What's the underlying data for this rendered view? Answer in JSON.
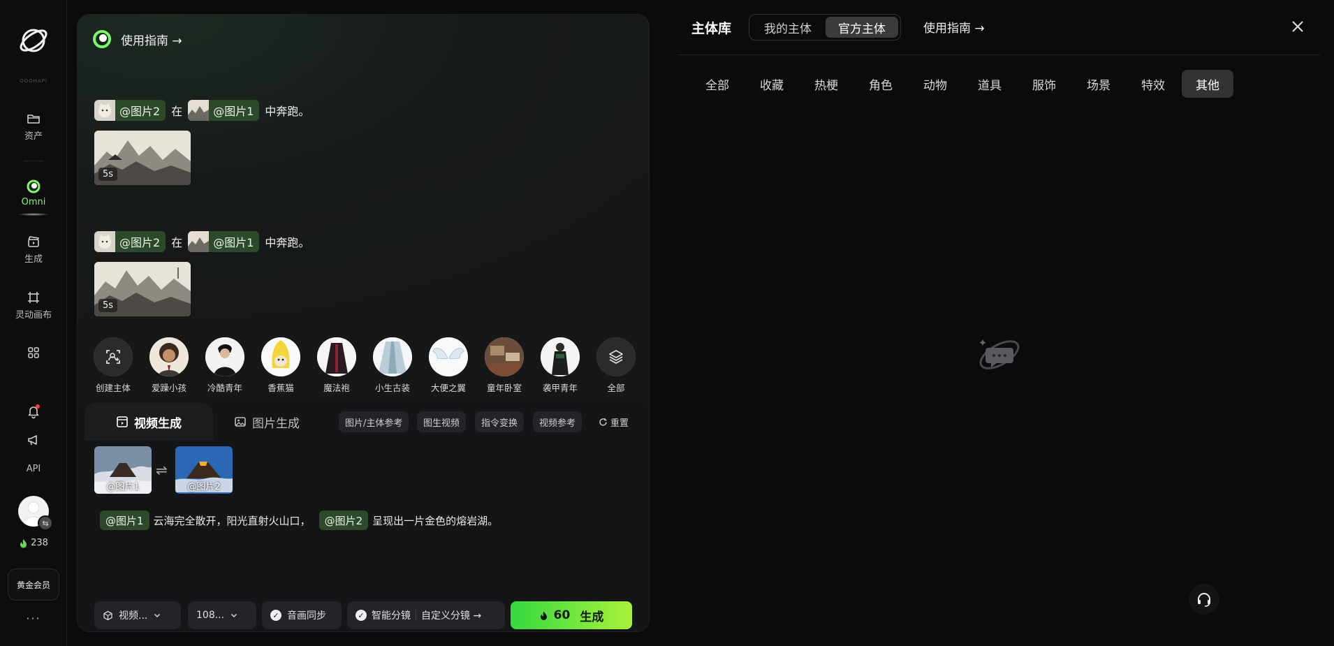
{
  "rail": {
    "brand_small": "OOOHAPI",
    "assets_label": "资产",
    "omni_label": "Omni",
    "generate_label": "生成",
    "canvas_label": "灵动画布",
    "api_label": "API",
    "credits": "238",
    "vip_label": "黄金会员",
    "more_label": "···"
  },
  "main": {
    "guide_label": "使用指南 →",
    "examples": [
      {
        "tag1": "@图片2",
        "connector": "在",
        "tag2": "@图片1",
        "suffix": "中奔跑。",
        "duration": "5s"
      },
      {
        "tag1": "@图片2",
        "connector": "在",
        "tag2": "@图片1",
        "suffix": "中奔跑。",
        "duration": "5s"
      }
    ],
    "characters": [
      {
        "name": "创建主体"
      },
      {
        "name": "爱躁小孩"
      },
      {
        "name": "冷酷青年"
      },
      {
        "name": "香蕉猫"
      },
      {
        "name": "魔法袍"
      },
      {
        "name": "小生古装"
      },
      {
        "name": "大便之翼"
      },
      {
        "name": "童年卧室"
      },
      {
        "name": "袭甲青年"
      },
      {
        "name": "全部"
      }
    ]
  },
  "composer": {
    "tab_video": "视频生成",
    "tab_image": "图片生成",
    "chips": [
      "图片/主体参考",
      "图生视频",
      "指令变换",
      "视频参考"
    ],
    "reset": "重置",
    "ref1": "@图片1",
    "ref2": "@图片2",
    "desc_tag1": "@图片1",
    "desc_text1": "云海完全散开，阳光直射火山口，",
    "desc_tag2": "@图片2",
    "desc_text2": "呈现出一片金色的熔岩湖。",
    "mode_label": "视频...",
    "res_label": "108...",
    "audio_sync": "音画同步",
    "smart_split": "智能分镜",
    "custom_split": "自定义分镜 →",
    "generate_cost": "60",
    "generate_label": "生成"
  },
  "drawer": {
    "title": "主体库",
    "seg_mine": "我的主体",
    "seg_official": "官方主体",
    "guide_label": "使用指南 →",
    "categories": [
      "全部",
      "收藏",
      "热梗",
      "角色",
      "动物",
      "道具",
      "服饰",
      "场景",
      "特效",
      "其他"
    ],
    "active_category": "其他"
  },
  "colors": {
    "accent_green": "#7ef86a",
    "generate_start": "#35d940",
    "generate_end": "#a9f23b",
    "tag_bg": "#2c4a2a"
  }
}
